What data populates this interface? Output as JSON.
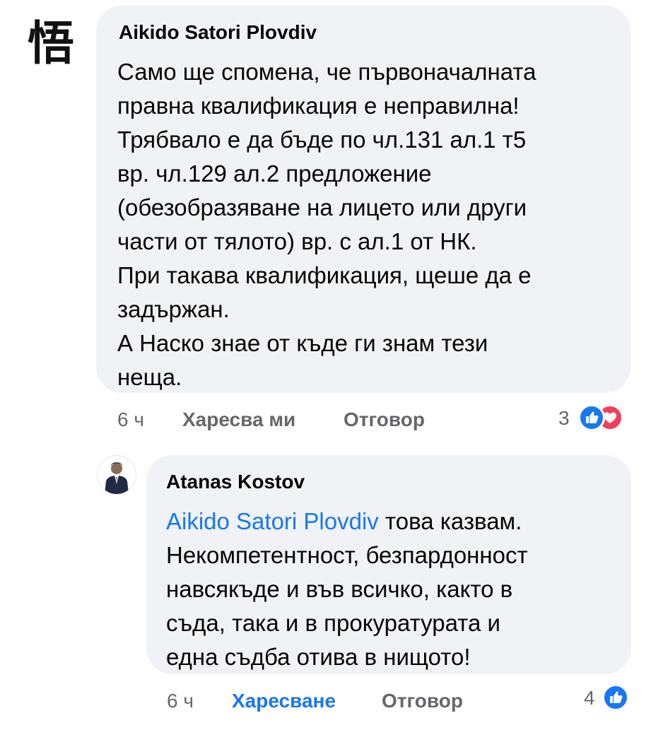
{
  "comments": [
    {
      "author": "Aikido Satori Plovdiv",
      "lines": [
        "Само ще спомена, че първоначалната",
        "правна квалификация е неправилна!",
        "Трябвало е да бъде по чл.131 ал.1 т5",
        "вр. чл.129 ал.2 предложение",
        "(обезобразяване на лицето или други",
        "части от тялото) вр. с ал.1 от НК.",
        "При такава квалификация, щеше да е",
        "задържан.",
        "А Наско знае от къде ги знам тези",
        "неща."
      ],
      "time": "6 ч",
      "like_label": "Харесва ми",
      "reply_label": "Отговор",
      "reaction_count": "3",
      "reactions": [
        "like",
        "love"
      ]
    },
    {
      "author": "Atanas Kostov",
      "mention": "Aikido Satori Plovdiv",
      "first_line_rest": " това казвам.",
      "lines": [
        "Некомпетентност, безпардонност",
        "навсякъде и във всичко, както в",
        "съда, така и в прокуратурата и",
        "една съдба отива в нищото!"
      ],
      "time": "6 ч",
      "like_label": "Харесване",
      "reply_label": "Отговор",
      "reaction_count": "4",
      "reactions": [
        "like"
      ]
    }
  ],
  "colors": {
    "bubble": "#f0f2f5",
    "meta": "#65676b",
    "link": "#1877f2",
    "like": "#1877f2",
    "love": "#f33e58"
  },
  "avatar1_logo": "悟"
}
